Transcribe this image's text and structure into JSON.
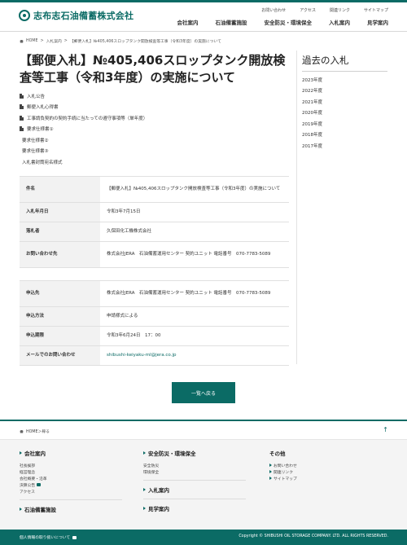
{
  "header": {
    "logo_text": "志布志石油備蓄株式会社",
    "utility_links": [
      "お問い合わせ",
      "アクセス",
      "関連リンク",
      "サイトマップ"
    ],
    "nav": [
      "会社案内",
      "石油備蓄施設",
      "安全防災・環境保全",
      "入札案内",
      "見学案内"
    ]
  },
  "breadcrumb": [
    "HOME",
    ">",
    "入札案内",
    ">",
    "【郵便入札】№405,406スロップタンク開放検査等工事（令和3年度）の実施について"
  ],
  "main": {
    "title": "【郵便入札】№405,406スロップタンク開放検査等工事（令和3年度）の実施について",
    "documents": [
      {
        "label": "入札公告",
        "icon": true
      },
      {
        "label": "郵便入札心得書",
        "icon": true
      },
      {
        "label": "工事請負契約の契約手続に当たっての遵守事項等（単年度）",
        "icon": true
      },
      {
        "label": "要求仕様書①",
        "icon": true
      },
      {
        "label": "要求仕様書②",
        "icon": false
      },
      {
        "label": "要求仕様書③",
        "icon": false
      },
      {
        "label": "入札書封筒宛名様式",
        "icon": false
      }
    ],
    "table1": [
      {
        "label": "件名",
        "value": "【郵便入札】№405,406スロップタンク開放検査等工事（令和3年度）の実施について"
      },
      {
        "label": "入札年月日",
        "value": "令和3年7月15日"
      },
      {
        "label": "落札者",
        "value": "久保田化工機株式会社"
      },
      {
        "label": "お問い合わせ先",
        "value": "株式会社JERA　石油備蓄運用センター 契約ユニット 電話番号　070-7783-5089"
      }
    ],
    "table2": [
      {
        "label": "申込先",
        "value": "株式会社JERA　石油備蓄運用センター 契約ユニット 電話番号　070-7783-5089"
      },
      {
        "label": "申込方法",
        "value": "申請様式による"
      },
      {
        "label": "申込期限",
        "value": "令和3年6月24日　17：00"
      },
      {
        "label": "メールでのお問い合わせ",
        "value": "shibushi-keiyaku-ml@jera.co.jp"
      }
    ],
    "back_button": "一覧へ戻る"
  },
  "sidebar": {
    "title": "過去の入札",
    "years": [
      "2023年度",
      "2022年度",
      "2021年度",
      "2020年度",
      "2019年度",
      "2018年度",
      "2017年度"
    ]
  },
  "footer": {
    "breadcrumb": "HOME＞稼る",
    "pagetop": "↑",
    "col1": {
      "head": "会社案内",
      "items": [
        "社長挨拶",
        "経営理念",
        "会社概要・沿革",
        "決算公告",
        "アクセス"
      ],
      "head2": "石油備蓄施設"
    },
    "col2": {
      "head": "安全防災・環境保全",
      "items": [
        "安全防災",
        "環境保全"
      ],
      "head2": "入札案内",
      "head3": "見学案内"
    },
    "col3": {
      "head": "その他",
      "items": [
        "お問い合わせ",
        "関連リンク",
        "サイトマップ"
      ]
    },
    "bottom_left": "個人情報の取り扱いについて",
    "copyright": "Copyright © SHIBUSHI OIL STORAGE COMPANY. LTD. ALL RIGHTS RESERVED."
  }
}
